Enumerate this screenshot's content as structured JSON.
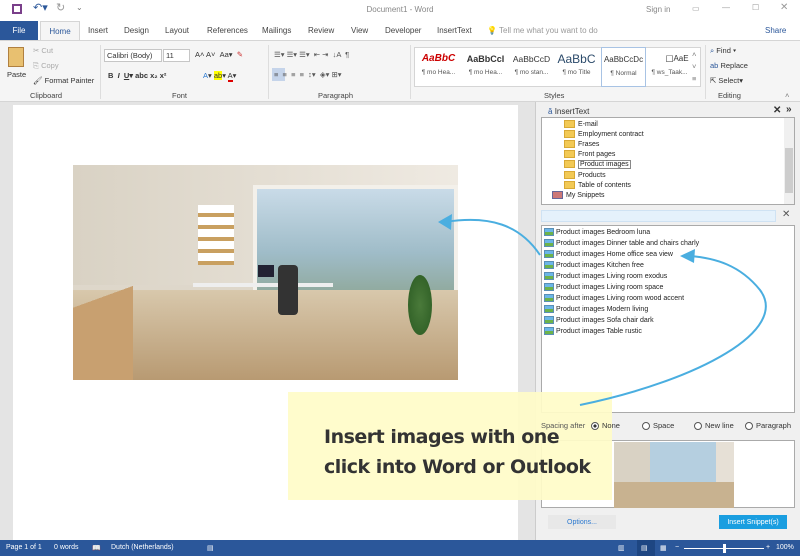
{
  "window": {
    "title": "Document1 - Word",
    "sign_in": "Sign in",
    "share": "Share"
  },
  "tabs": [
    "File",
    "Home",
    "Insert",
    "Design",
    "Layout",
    "References",
    "Mailings",
    "Review",
    "View",
    "Developer",
    "InsertText"
  ],
  "tell_me": "Tell me what you want to do",
  "clipboard": {
    "paste": "Paste",
    "cut": "Cut",
    "copy": "Copy",
    "format_painter": "Format Painter",
    "label": "Clipboard"
  },
  "font": {
    "name": "Calibri (Body)",
    "size": "11",
    "label": "Font"
  },
  "paragraph": {
    "label": "Paragraph"
  },
  "styles": {
    "label": "Styles",
    "items": [
      {
        "preview": "AaBbC",
        "name": "¶ mo Hea..."
      },
      {
        "preview": "AaBbCcI",
        "name": "¶ mo Hea..."
      },
      {
        "preview": "AaBbCcD",
        "name": "¶ mo stan..."
      },
      {
        "preview": "AaBbC",
        "name": "¶ mo Title"
      },
      {
        "preview": "AaBbCcDc",
        "name": "¶ Normal"
      },
      {
        "preview": "☐",
        "name": "¶ ws_Taak..."
      },
      {
        "preview": "AaE",
        "name": ""
      }
    ]
  },
  "editing": {
    "find": "Find",
    "replace": "Replace",
    "select": "Select",
    "label": "Editing"
  },
  "pane": {
    "title": "InsertText",
    "tree": [
      "E-mail",
      "Employment contract",
      "Frases",
      "Front pages",
      "Product images",
      "Products",
      "Table of contents"
    ],
    "my_snippets": "My Snippets",
    "search_value": "",
    "items": [
      "Product images Bedroom luna",
      "Product images Dinner table and chairs charly",
      "Product images Home office sea view",
      "Product images Kitchen free",
      "Product images Living room exodus",
      "Product images Living room space",
      "Product images Living room wood accent",
      "Product images Modern living",
      "Product images Sofa chair dark",
      "Product images Table rustic"
    ],
    "spacing_label": "Spacing after",
    "radios": [
      "None",
      "Space",
      "New line",
      "Paragraph"
    ],
    "options": "Options...",
    "insert": "Insert Snippet(s)"
  },
  "callout": {
    "line1": "Insert images with one",
    "line2": "click into Word or Outlook"
  },
  "status": {
    "page": "Page 1 of 1",
    "words": "0 words",
    "language": "Dutch (Netherlands)",
    "zoom": "100%",
    "zoom_value": 100
  },
  "colors": {
    "word_blue": "#2b579a",
    "accent": "#1a9ee0",
    "arrow": "#4aaee0"
  }
}
